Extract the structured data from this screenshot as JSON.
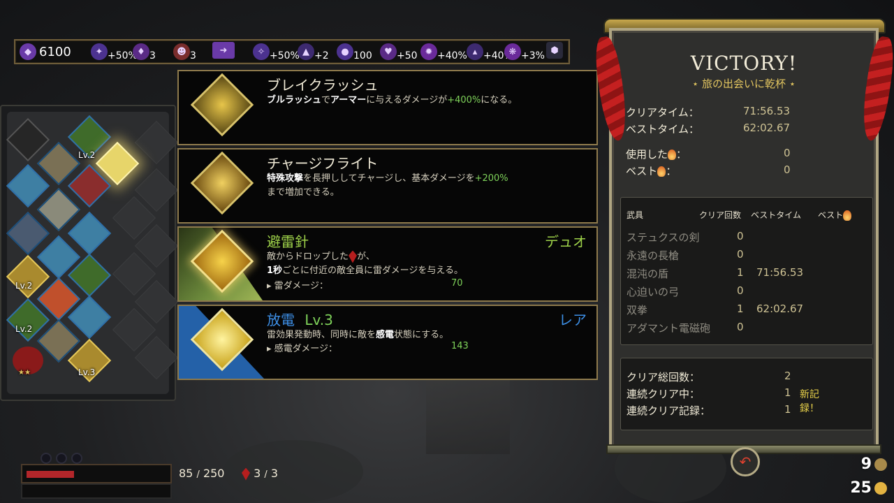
{
  "resources": [
    {
      "icon": "darkness-icon",
      "value": "6100"
    },
    {
      "icon": "gemstone-bonus-icon",
      "value": "+50%"
    },
    {
      "icon": "nectar-icon",
      "value": "3"
    },
    {
      "icon": "companion-icon",
      "value": "3"
    },
    {
      "icon": "door-key-icon",
      "value": ""
    },
    {
      "icon": "darkness-bonus-icon",
      "value": "+50%"
    },
    {
      "icon": "crystal-icon",
      "value": "+2"
    },
    {
      "icon": "orb-icon",
      "value": "100"
    },
    {
      "icon": "heart-icon",
      "value": "+50"
    },
    {
      "icon": "gem-burst-icon",
      "value": "+40%"
    },
    {
      "icon": "titan-blood-icon",
      "value": "+40%"
    },
    {
      "icon": "ambrosia-icon",
      "value": "+3%"
    },
    {
      "icon": "cube-icon",
      "value": ""
    }
  ],
  "boon_panel": {
    "levels": {
      "a": "Lv.2",
      "b": "Lv.2",
      "c": "Lv.2",
      "d": "Lv.3"
    },
    "stars": "★★"
  },
  "cards": [
    {
      "title": "ブレイクラッシュ",
      "desc_parts": [
        "ブルラッシュ",
        "で",
        "アーマー",
        "に与えるダメージが",
        "+400%",
        "になる。"
      ],
      "rarity": ""
    },
    {
      "title": "チャージフライト",
      "desc_parts": [
        "特殊攻撃",
        "を長押ししてチャージし、基本ダメージを",
        "+200%",
        "まで増加できる。"
      ],
      "rarity": ""
    },
    {
      "title": "避雷針",
      "line1_a": "敵からドロップした",
      "line1_b": "が、",
      "line2_a": "1秒",
      "line2_b": "ごとに付近の敵全員に雷ダメージを与える。",
      "stat_label": "雷ダメージ：",
      "stat_value": "70",
      "rarity": "デュオ",
      "rarity_color": "#9fd34a"
    },
    {
      "title": "放電",
      "level": "Lv.3",
      "line1_a": "雷効果発動時、同時に敵を",
      "line1_b": "感電",
      "line1_c": "状態にする。",
      "stat_label": "感電ダメージ：",
      "stat_value": "143",
      "rarity": "レア",
      "rarity_color": "#3d8fe6"
    }
  ],
  "victory": {
    "title": "VICTORY!",
    "subtitle": "旅の出会いに乾杯",
    "clear_time_label": "クリアタイム：",
    "clear_time": "71:56.53",
    "best_time_label": "ベストタイム：",
    "best_time": "62:02.67",
    "used_label": "使用した",
    "used_value": "0",
    "best_label": "ベスト",
    "best_value": "0",
    "table_headers": {
      "weapon": "武具",
      "clears": "クリア回数",
      "best_time": "ベストタイム",
      "best": "ベスト"
    },
    "weapons": [
      {
        "name": "ステュクスの剣",
        "clears": "0",
        "time": ""
      },
      {
        "name": "永遠の長槍",
        "clears": "0",
        "time": ""
      },
      {
        "name": "混沌の盾",
        "clears": "1",
        "time": "71:56.53"
      },
      {
        "name": "心迫いの弓",
        "clears": "0",
        "time": ""
      },
      {
        "name": "双拳",
        "clears": "1",
        "time": "62:02.67"
      },
      {
        "name": "アダマント電磁砲",
        "clears": "0",
        "time": ""
      }
    ],
    "total_clears_label": "クリア総回数：",
    "total_clears": "2",
    "streak_label": "連続クリア中：",
    "streak": "1",
    "new_record": "新記録！",
    "streak_record_label": "連続クリア記録：",
    "streak_record": "1"
  },
  "health": {
    "current": "85",
    "sep": "/",
    "max": "250",
    "fraction": 0.34
  },
  "death_defiance": {
    "current": "3",
    "sep": "/",
    "max": "3"
  },
  "corner": {
    "top_value": "9",
    "bottom_value": "25"
  },
  "colors": {
    "accent_green": "#7fd35a",
    "gold": "#e3c660",
    "duo": "#9fd34a",
    "rare": "#3d8fe6",
    "health": "#b3262a"
  }
}
